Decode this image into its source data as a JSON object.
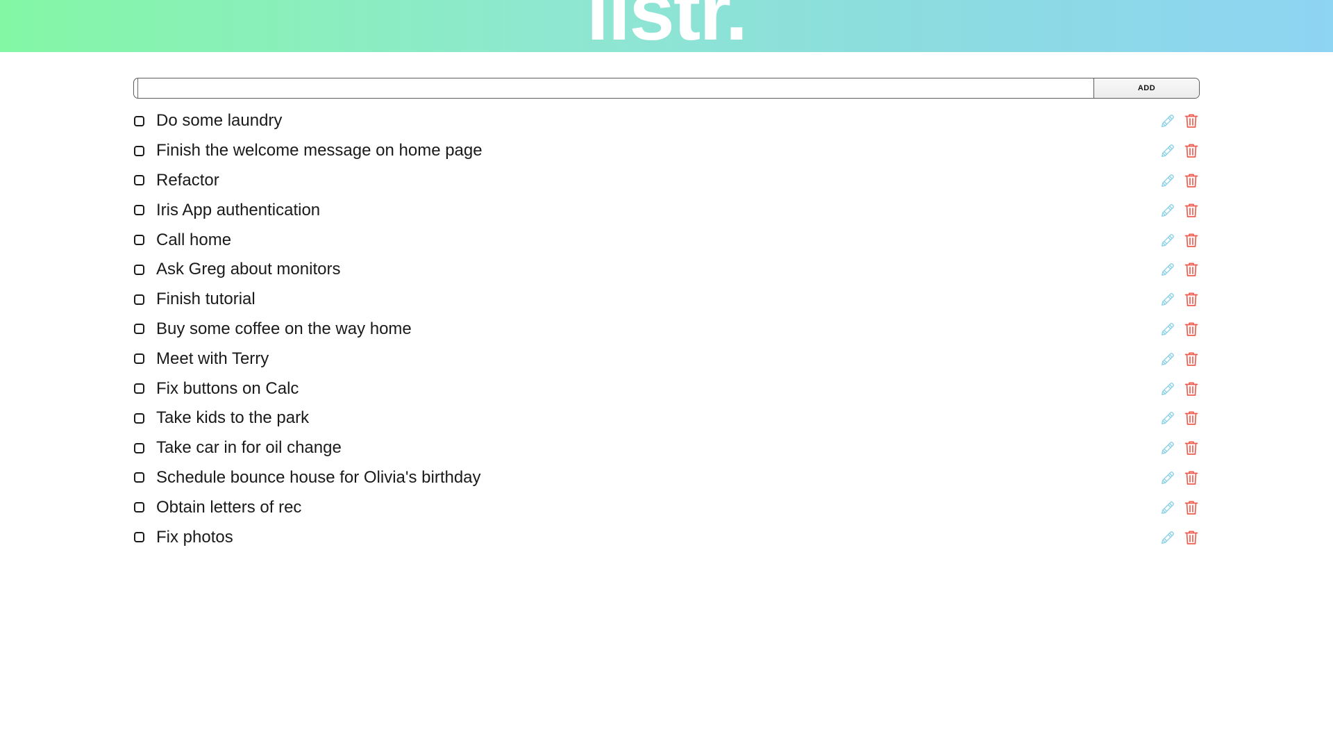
{
  "app": {
    "logo": "listr."
  },
  "add_form": {
    "input_value": "",
    "input_placeholder": "",
    "add_label": "ADD"
  },
  "colors": {
    "edit_icon": "#8fd3e8",
    "delete_icon": "#ef5c4f",
    "header_gradient": [
      "#84f7a5",
      "#8ed4f3"
    ]
  },
  "tasks": [
    {
      "label": "Do some laundry",
      "checked": false
    },
    {
      "label": "Finish the welcome message on home page",
      "checked": false
    },
    {
      "label": "Refactor",
      "checked": false
    },
    {
      "label": "Iris App authentication",
      "checked": false
    },
    {
      "label": "Call home",
      "checked": false
    },
    {
      "label": "Ask Greg about monitors",
      "checked": false
    },
    {
      "label": "Finish tutorial",
      "checked": false
    },
    {
      "label": "Buy some coffee on the way home",
      "checked": false
    },
    {
      "label": "Meet with Terry",
      "checked": false
    },
    {
      "label": "Fix buttons on Calc",
      "checked": false
    },
    {
      "label": "Take kids to the park",
      "checked": false
    },
    {
      "label": "Take car in for oil change",
      "checked": false
    },
    {
      "label": "Schedule bounce house for Olivia's birthday",
      "checked": false
    },
    {
      "label": "Obtain letters of rec",
      "checked": false
    },
    {
      "label": "Fix photos",
      "checked": false
    }
  ],
  "icons": {
    "edit": "pencil-icon",
    "delete": "trash-icon"
  }
}
